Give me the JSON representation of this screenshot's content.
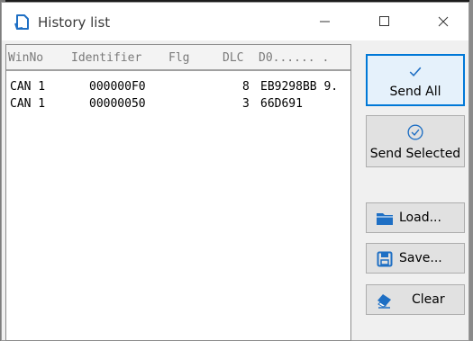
{
  "window": {
    "title": "History list",
    "icon": "history-document-icon",
    "controls": [
      "minimize-icon",
      "maximize-icon",
      "close-icon"
    ]
  },
  "list": {
    "columns": [
      "WinNo",
      "Identifier",
      "Flg",
      "DLC",
      "D0...... ."
    ],
    "rows": [
      {
        "winno": "CAN 1",
        "identifier": "000000F0",
        "flg": "",
        "dlc": "8",
        "data": "EB9298BB 9."
      },
      {
        "winno": "CAN 1",
        "identifier": "00000050",
        "flg": "",
        "dlc": "3",
        "data": "66D691"
      }
    ]
  },
  "buttons": {
    "send_all": {
      "label": "Send All",
      "icon": "checkmark-icon"
    },
    "send_selected": {
      "label": "Send Selected",
      "icon": "circle-check-icon"
    },
    "load": {
      "label": "Load...",
      "icon": "folder-icon"
    },
    "save": {
      "label": "Save...",
      "icon": "floppy-disk-icon"
    },
    "clear": {
      "label": "Clear",
      "icon": "eraser-icon"
    }
  },
  "colors": {
    "accent": "#0078d7",
    "icon_blue": "#1e6fc4",
    "window_bg": "#f0f0f0"
  }
}
